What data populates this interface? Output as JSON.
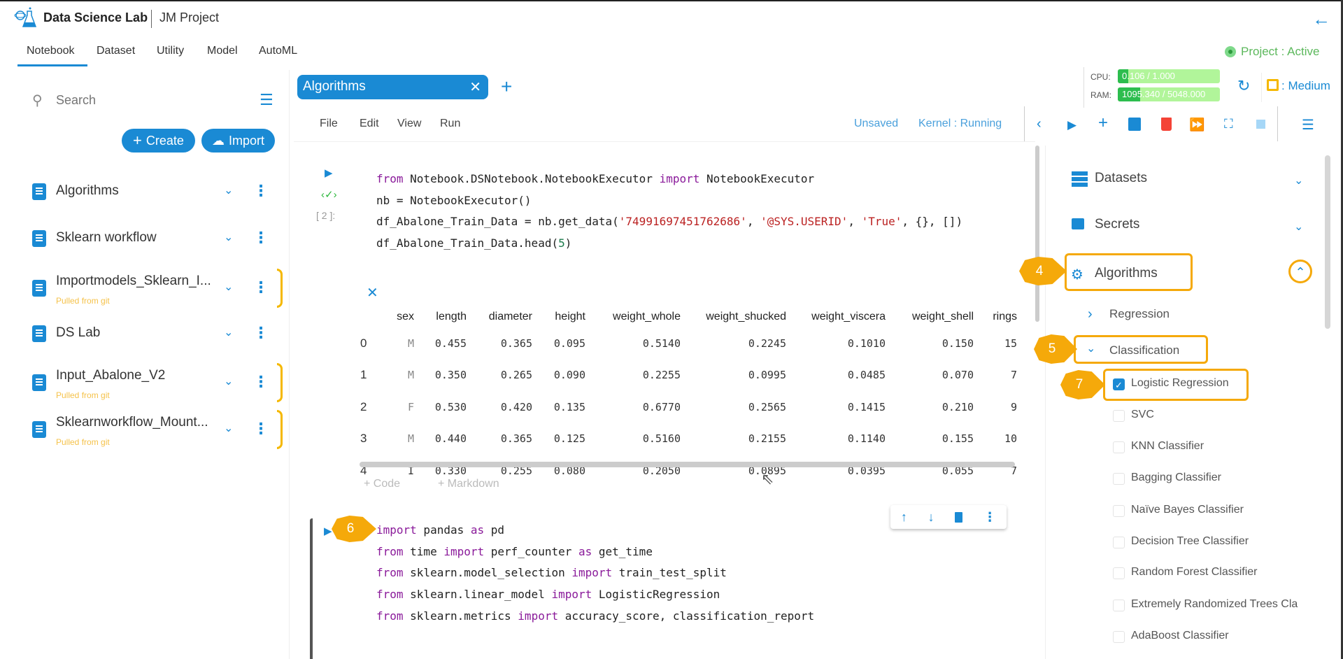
{
  "header": {
    "app_title": "Data Science Lab",
    "project_name": "JM Project",
    "status": "Project : Active"
  },
  "nav_tabs": [
    "Notebook",
    "Dataset",
    "Utility",
    "Model",
    "AutoML"
  ],
  "sidebar": {
    "search_placeholder": "Search",
    "create_label": "Create",
    "import_label": "Import",
    "notebooks": [
      {
        "name": "Algorithms",
        "sub": ""
      },
      {
        "name": "Sklearn workflow",
        "sub": ""
      },
      {
        "name": "Importmodels_Sklearn_I...",
        "sub": "Pulled from git"
      },
      {
        "name": "DS Lab",
        "sub": ""
      },
      {
        "name": "Input_Abalone_V2",
        "sub": "Pulled from git"
      },
      {
        "name": "Sklearnworkflow_Mount...",
        "sub": "Pulled from git"
      }
    ]
  },
  "notebook_tab": {
    "title": "Algorithms"
  },
  "resources": {
    "cpu_label": "CPU:",
    "cpu_value": "0.106 / 1.000",
    "cpu_fraction": 0.106,
    "ram_label": "RAM:",
    "ram_value": "1095.340 / 5048.000",
    "ram_fraction": 0.217,
    "size": ": Medium"
  },
  "menu": {
    "items": [
      "File",
      "Edit",
      "View",
      "Run"
    ],
    "save_state": "Unsaved",
    "kernel": "Kernel : Running"
  },
  "cell1": {
    "exec_count": "[ 2 ]:",
    "lines": [
      [
        [
          "from",
          "kw"
        ],
        [
          " Notebook.DSNotebook.NotebookExecutor ",
          ""
        ],
        [
          "import",
          "kw"
        ],
        [
          " NotebookExecutor",
          ""
        ]
      ],
      [
        [
          "nb = NotebookExecutor()",
          ""
        ]
      ],
      [
        [
          "df_Abalone_Train_Data = nb.get_data(",
          ""
        ],
        [
          "'74991697451762686'",
          "str"
        ],
        [
          ", ",
          ""
        ],
        [
          "'@SYS.USERID'",
          "str"
        ],
        [
          ", ",
          ""
        ],
        [
          "'True'",
          "str"
        ],
        [
          ", {}, [])",
          ""
        ]
      ],
      [
        [
          "df_Abalone_Train_Data.head(",
          ""
        ],
        [
          "5",
          "num"
        ],
        [
          ")",
          ""
        ]
      ]
    ]
  },
  "output_table": {
    "columns": [
      "",
      "sex",
      "length",
      "diameter",
      "height",
      "weight_whole",
      "weight_shucked",
      "weight_viscera",
      "weight_shell",
      "rings"
    ],
    "rows": [
      [
        "0",
        "M",
        "0.455",
        "0.365",
        "0.095",
        "0.5140",
        "0.2245",
        "0.1010",
        "0.150",
        "15"
      ],
      [
        "1",
        "M",
        "0.350",
        "0.265",
        "0.090",
        "0.2255",
        "0.0995",
        "0.0485",
        "0.070",
        "7"
      ],
      [
        "2",
        "F",
        "0.530",
        "0.420",
        "0.135",
        "0.6770",
        "0.2565",
        "0.1415",
        "0.210",
        "9"
      ],
      [
        "3",
        "M",
        "0.440",
        "0.365",
        "0.125",
        "0.5160",
        "0.2155",
        "0.1140",
        "0.155",
        "10"
      ],
      [
        "4",
        "I",
        "0.330",
        "0.255",
        "0.080",
        "0.2050",
        "0.0895",
        "0.0395",
        "0.055",
        "7"
      ]
    ]
  },
  "add_cell": {
    "code": "Code",
    "markdown": "Markdown"
  },
  "cell2": {
    "lines": [
      [
        [
          "import",
          "kw"
        ],
        [
          " pandas ",
          ""
        ],
        [
          "as",
          "kw"
        ],
        [
          " pd",
          ""
        ]
      ],
      [
        [
          "from",
          "kw"
        ],
        [
          " time ",
          ""
        ],
        [
          "import",
          "kw"
        ],
        [
          " perf_counter ",
          ""
        ],
        [
          "as",
          "kw"
        ],
        [
          " get_time",
          ""
        ]
      ],
      [
        [
          "from",
          "kw"
        ],
        [
          " sklearn.model_selection ",
          ""
        ],
        [
          "import",
          "kw"
        ],
        [
          " train_test_split",
          ""
        ]
      ],
      [
        [
          "from",
          "kw"
        ],
        [
          " sklearn.linear_model ",
          ""
        ],
        [
          "import",
          "kw"
        ],
        [
          " LogisticRegression",
          ""
        ]
      ],
      [
        [
          "from",
          "kw"
        ],
        [
          " sklearn.metrics ",
          ""
        ],
        [
          "import",
          "kw"
        ],
        [
          " accuracy_score, classification_report",
          ""
        ]
      ]
    ]
  },
  "right_panel": {
    "sections": [
      "Datasets",
      "Secrets",
      "Algorithms"
    ],
    "categories": [
      "Regression",
      "Classification"
    ],
    "classifiers": [
      {
        "label": "Logistic Regression",
        "checked": true
      },
      {
        "label": "SVC",
        "checked": false
      },
      {
        "label": "KNN Classifier",
        "checked": false
      },
      {
        "label": "Bagging Classifier",
        "checked": false
      },
      {
        "label": "Naïve Bayes Classifier",
        "checked": false
      },
      {
        "label": "Decision Tree Classifier",
        "checked": false
      },
      {
        "label": "Random Forest Classifier",
        "checked": false
      },
      {
        "label": "Extremely Randomized Trees Cla",
        "checked": false
      },
      {
        "label": "AdaBoost Classifier",
        "checked": false
      }
    ]
  },
  "annotations": [
    "4",
    "5",
    "6",
    "7"
  ],
  "colors": {
    "accent": "#1a8ad4",
    "annotation": "#f5a90a",
    "active": "#5cb85c",
    "git": "#f5c24a",
    "delete": "#f44336"
  }
}
